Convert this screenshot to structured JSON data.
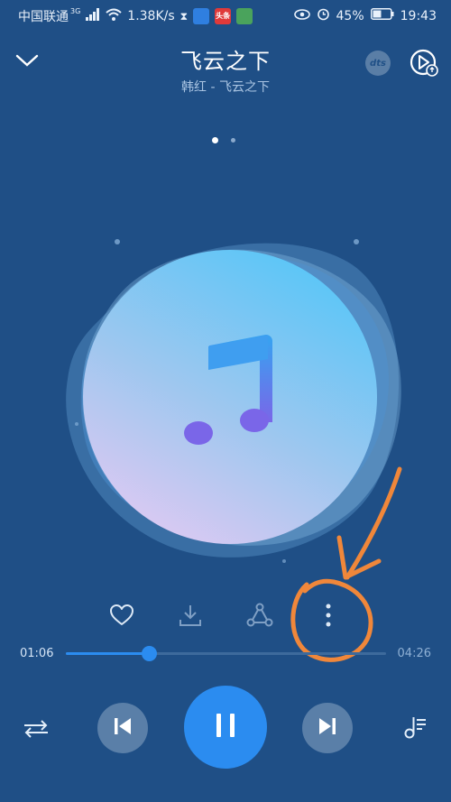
{
  "status_bar": {
    "carrier": "中国联通",
    "network_type": "3G",
    "speed": "1.38K/s",
    "app_icons": [
      "hourglass-icon",
      "app-blue-icon",
      "toutiao-icon",
      "app-green-icon"
    ],
    "app_badge_text": "头条",
    "battery": "45%",
    "time": "19:43"
  },
  "header": {
    "title": "飞云之下",
    "subtitle": "韩红 - 飞云之下",
    "dts_label": "dts"
  },
  "pager": {
    "count": 2,
    "active": 0
  },
  "actions": [
    "heart-icon",
    "download-icon",
    "share-icon",
    "more-icon"
  ],
  "playback": {
    "current_time": "01:06",
    "total_time": "04:26",
    "progress": 0.26,
    "state": "playing"
  },
  "controls": [
    "repeat-icon",
    "previous-icon",
    "pause-icon",
    "next-icon",
    "playlist-icon"
  ],
  "colors": {
    "background": "#1f4f86",
    "accent": "#2b8cf0",
    "annotation": "#f0873a"
  }
}
